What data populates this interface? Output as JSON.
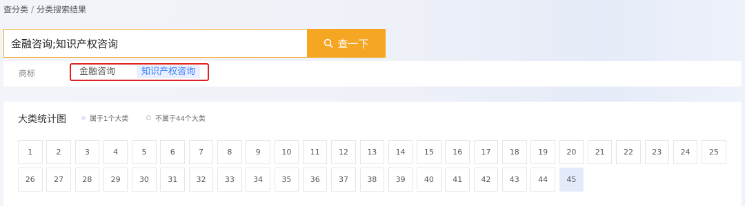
{
  "breadcrumb": {
    "root": "查分类",
    "separator": "/",
    "current": "分类搜索结果"
  },
  "search": {
    "value": "金融咨询;知识产权咨询",
    "button_label": "查一下",
    "accent_color": "#f5a623"
  },
  "tags": {
    "category_label": "商标",
    "items": [
      {
        "label": "金融咨询",
        "selected": false
      },
      {
        "label": "知识产权咨询",
        "selected": true
      }
    ],
    "highlight_color": "#e02020"
  },
  "stats": {
    "title": "大类统计图",
    "legend": {
      "belongs": "属于1个大类",
      "not_belongs": "不属于44个大类"
    },
    "classes": [
      "1",
      "2",
      "3",
      "4",
      "5",
      "6",
      "7",
      "8",
      "9",
      "10",
      "11",
      "12",
      "13",
      "14",
      "15",
      "16",
      "17",
      "18",
      "19",
      "20",
      "21",
      "22",
      "23",
      "24",
      "25",
      "26",
      "27",
      "28",
      "29",
      "30",
      "31",
      "32",
      "33",
      "34",
      "35",
      "36",
      "37",
      "38",
      "39",
      "40",
      "41",
      "42",
      "43",
      "44",
      "45"
    ],
    "highlighted_class": "45"
  }
}
